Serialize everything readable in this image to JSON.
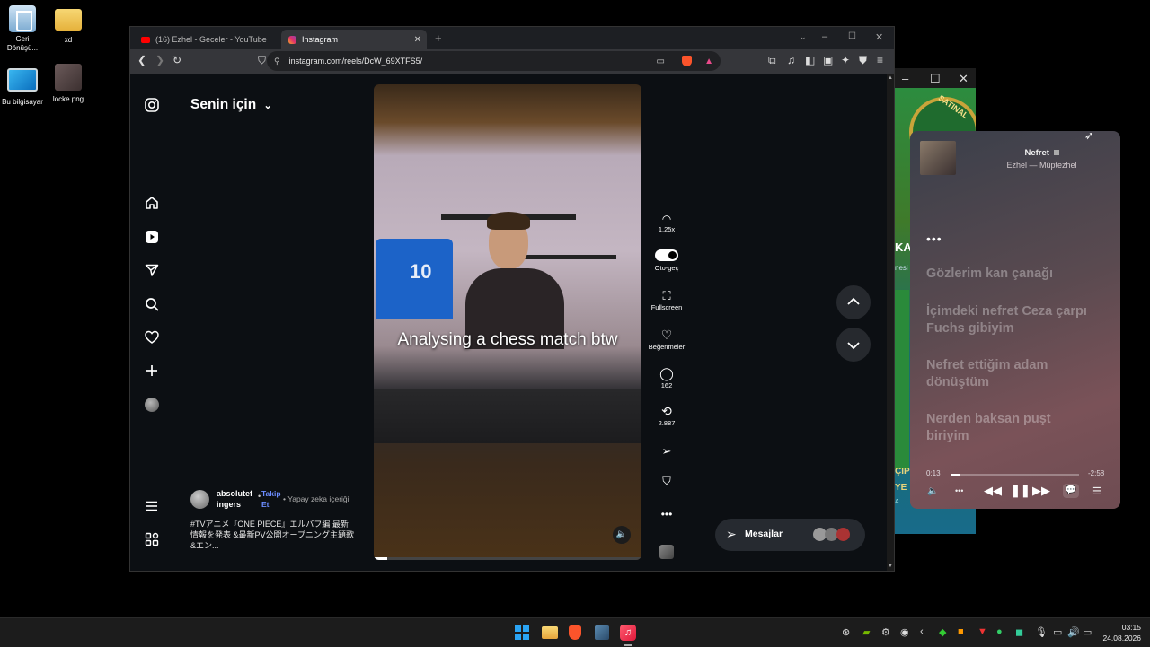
{
  "desktop": {
    "icons": [
      {
        "label": "Geri Dönüşü..."
      },
      {
        "label": "xd"
      },
      {
        "label": "Bu bilgisayar"
      },
      {
        "label": "locke.png"
      }
    ]
  },
  "browser": {
    "tabs": [
      {
        "title": "(16) Ezhel - Geceler - YouTube"
      },
      {
        "title": "Instagram"
      }
    ],
    "url": "instagram.com/reels/DcW_69XTFS5/"
  },
  "instagram": {
    "feed_title": "Senin için",
    "caption_overlay": "Analysing a chess match btw",
    "author": {
      "username": "absolutef ingers",
      "follow_label": "Takip Et",
      "ai_label": "Yapay zeka içeriği"
    },
    "description": "#TVアニメ『ONE PIECE』エルバフ編 最新情報を発表 &最新PV公開オープニング主題歌&エン...",
    "actions": {
      "speed": "1.25x",
      "autoplay": "Oto-geç",
      "fullscreen": "Fullscreen",
      "likes": "Beğenmeler",
      "comments": "162",
      "reposts": "2.887"
    },
    "messages_label": "Mesajlar",
    "video_progress": 0.05
  },
  "music_widget": {
    "song": "Nefret",
    "artist_album": "Ezhel — Müptezhel",
    "lyrics": [
      "Gözlerim kan çanağı",
      "İçimdeki nefret Ceza çarpı Fuchs gibiyim",
      "Nefret ettiğim adam dönüştüm",
      "Nerden baksan puşt biriyim"
    ],
    "elapsed": "0:13",
    "remaining": "-2:58",
    "progress": 0.07
  },
  "game_window": {
    "visible_text": [
      "SATINAL",
      "KA",
      "nesi",
      "ÇIP",
      "YE",
      "A"
    ]
  },
  "taskbar": {
    "time": "03:15",
    "date": "24.08.2026"
  }
}
